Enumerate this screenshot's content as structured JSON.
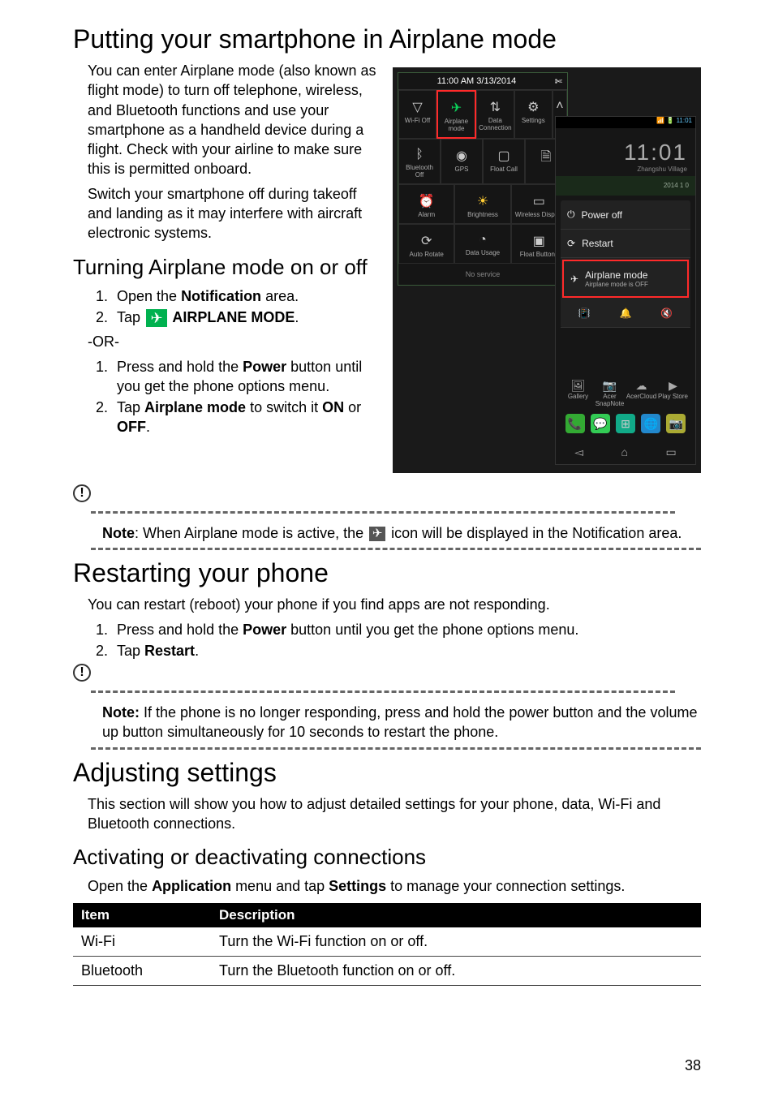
{
  "page_number": "38",
  "h1_airplane": "Putting your smartphone in Airplane mode",
  "p_airplane_intro": "You can enter Airplane mode (also known as flight mode) to turn off telephone, wireless, and Bluetooth functions and use your smartphone as a handheld device during a flight. Check with your airline to make sure this is permitted onboard.",
  "p_airplane_warn": "Switch your smartphone off during takeoff and landing as it may interfere with aircraft electronic systems.",
  "h2_turn": "Turning Airplane mode on or off",
  "ol1": {
    "i1_a": "Open the ",
    "i1_b": "Notification",
    "i1_c": " area.",
    "i2_a": "Tap ",
    "i2_b": " AIRPLANE MODE",
    "i2_c": "."
  },
  "or_text": "-OR-",
  "ol2": {
    "i1_a": "Press and hold the ",
    "i1_b": "Power",
    "i1_c": " button until you get the phone options menu.",
    "i2_a": "Tap ",
    "i2_b": "Airplane mode",
    "i2_c": " to switch it ",
    "i2_d": "ON",
    "i2_e": " or ",
    "i2_f": "OFF",
    "i2_g": "."
  },
  "note1_a": "Note",
  "note1_b": ": When Airplane mode is active, the ",
  "note1_c": " icon will be displayed in the Notification area.",
  "h1_restart": "Restarting your phone",
  "p_restart_intro": "You can restart (reboot) your phone if you find apps are not responding.",
  "ol3": {
    "i1_a": "Press and hold the ",
    "i1_b": "Power",
    "i1_c": " button until you get the phone options menu.",
    "i2_a": "Tap ",
    "i2_b": "Restart",
    "i2_c": "."
  },
  "note2_a": "Note:",
  "note2_b": " If the phone is no longer responding, press and hold the power button and the volume up button simultaneously for 10 seconds to restart the phone.",
  "h1_adjust": "Adjusting settings",
  "p_adjust_intro": "This section will show you how to adjust detailed settings for your phone, data, Wi-Fi and Bluetooth connections.",
  "h2_conn": "Activating or deactivating connections",
  "p_conn_a": "Open the ",
  "p_conn_b": "Application",
  "p_conn_c": " menu and tap ",
  "p_conn_d": "Settings",
  "p_conn_e": " to manage your connection settings.",
  "table": {
    "h_item": "Item",
    "h_desc": "Description",
    "rows": [
      {
        "item": "Wi-Fi",
        "desc": "Turn the Wi-Fi function on or off."
      },
      {
        "item": "Bluetooth",
        "desc": "Turn the Bluetooth function on or off."
      }
    ]
  },
  "fig": {
    "qs_time": "11:00 AM 3/13/2014",
    "scissors": "✄",
    "tiles": {
      "wifi": "Wi-Fi Off",
      "airplane": "Airplane mode",
      "data": "Data Connection",
      "settings": "Settings",
      "bt": "Bluetooth Off",
      "gps": "GPS",
      "float": "Float Call",
      "alarm": "Alarm",
      "bright": "Brightness",
      "wd": "Wireless Display",
      "rotate": "Auto Rotate",
      "usage": "Data Usage",
      "fb": "Float Buttons"
    },
    "no_service": "No service",
    "statusbar_time": "11:01",
    "clock_big": "11:01",
    "clock_place": "Zhangshu Village",
    "weather": "2014  1 0",
    "power": {
      "off": "Power off",
      "restart": "Restart",
      "air_t": "Airplane mode",
      "air_s": "Airplane mode is OFF"
    },
    "dock_mid": {
      "gallery": "Gallery",
      "snap": "Acer SnapNote",
      "cloud": "AcerCloud",
      "play": "Play Store"
    }
  }
}
